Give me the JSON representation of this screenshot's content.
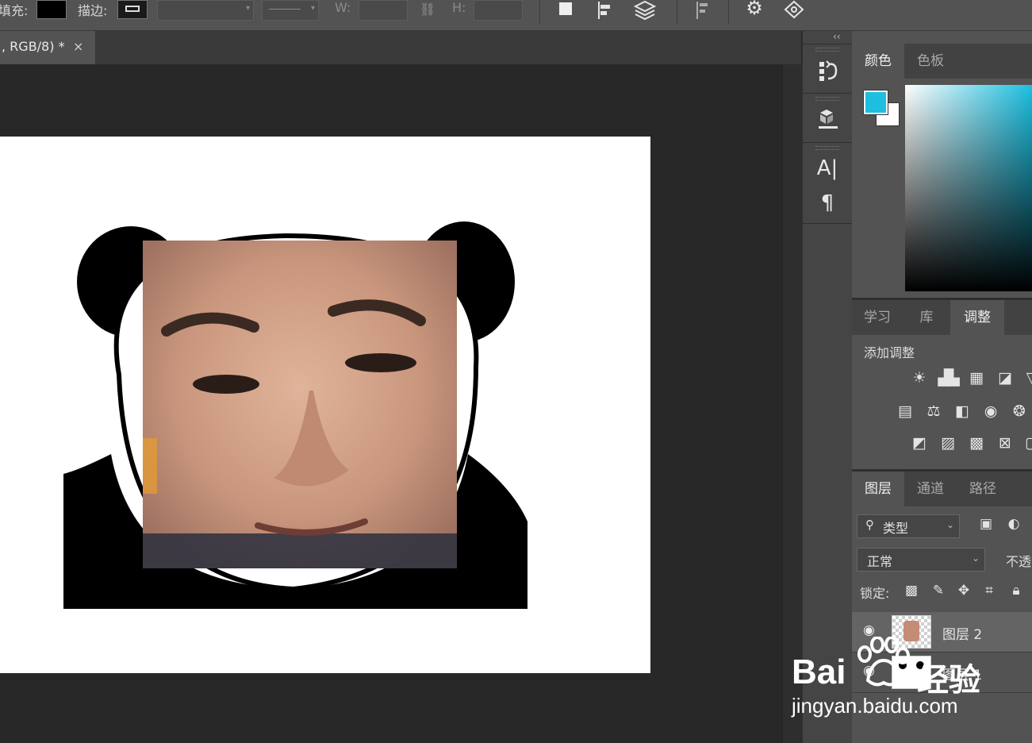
{
  "options_bar": {
    "fill_label": "填充:",
    "stroke_label": "描边:",
    "w_label": "W:",
    "h_label": "H:",
    "fill_color": "#000000"
  },
  "document_tab": {
    "title": ", RGB/8) *",
    "close_symbol": "×"
  },
  "dock": {
    "type_tool_glyph": "A|",
    "paragraph_glyph": "¶",
    "collapse_glyph": "‹‹"
  },
  "color_panel": {
    "tabs": [
      "颜色",
      "色板"
    ],
    "foreground_color": "#1cbfe0",
    "background_color": "#ffffff"
  },
  "adjustments_panel": {
    "tabs": [
      "学习",
      "库",
      "调整"
    ],
    "heading": "添加调整"
  },
  "layers_panel": {
    "tabs": [
      "图层",
      "通道",
      "路径"
    ],
    "filter_kind": "类型",
    "blend_mode": "正常",
    "opacity_label": "不透",
    "lock_label": "锁定:",
    "layers": [
      {
        "name": "图层 2",
        "selected": true
      },
      {
        "name": "图层 1",
        "selected": false
      }
    ]
  },
  "watermark": {
    "brand": "Bai",
    "brand_suffix": "经验",
    "url": "jingyan.baidu.com"
  }
}
